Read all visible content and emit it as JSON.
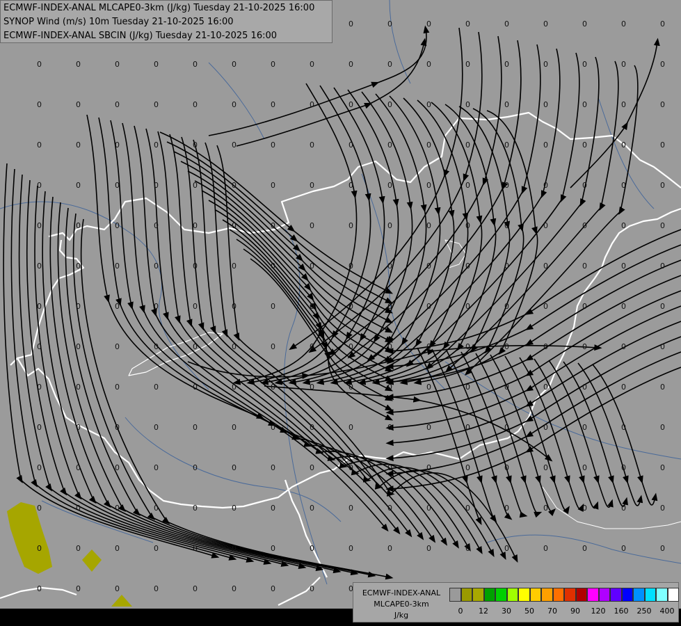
{
  "header": {
    "line1": "ECMWF-INDEX-ANAL MLCAPE0-3km (J/kg) Tuesday 21-10-2025 16:00",
    "line2": "SYNOP Wind (m/s) 10m Tuesday 21-10-2025 16:00",
    "line3": "ECMWF-INDEX-ANAL SBCIN (J/kg) Tuesday 21-10-2025 16:00"
  },
  "legend": {
    "title1": "ECMWF-INDEX-ANAL",
    "title2": "MLCAPE0-3km",
    "unit": "J/kg",
    "colors": [
      "#9a9a9a",
      "#9a9a00",
      "#a8a800",
      "#00a000",
      "#00d000",
      "#a0ff00",
      "#ffff00",
      "#ffcc00",
      "#ffa000",
      "#ff7000",
      "#e03000",
      "#b00000",
      "#ff00ff",
      "#b000ff",
      "#6000ff",
      "#0000ff",
      "#0090ff",
      "#00e0ff",
      "#80ffff",
      "#ffffff"
    ],
    "ticks": [
      "0",
      "12",
      "30",
      "50",
      "70",
      "90",
      "120",
      "160",
      "250",
      "400"
    ]
  },
  "map_colors": {
    "background": "#9b9b9b",
    "rivers": "#4a6a9a",
    "borders": "#ffffff",
    "streamlines": "#000000",
    "cape_fill": "#a6a600"
  },
  "cin_value": "0"
}
